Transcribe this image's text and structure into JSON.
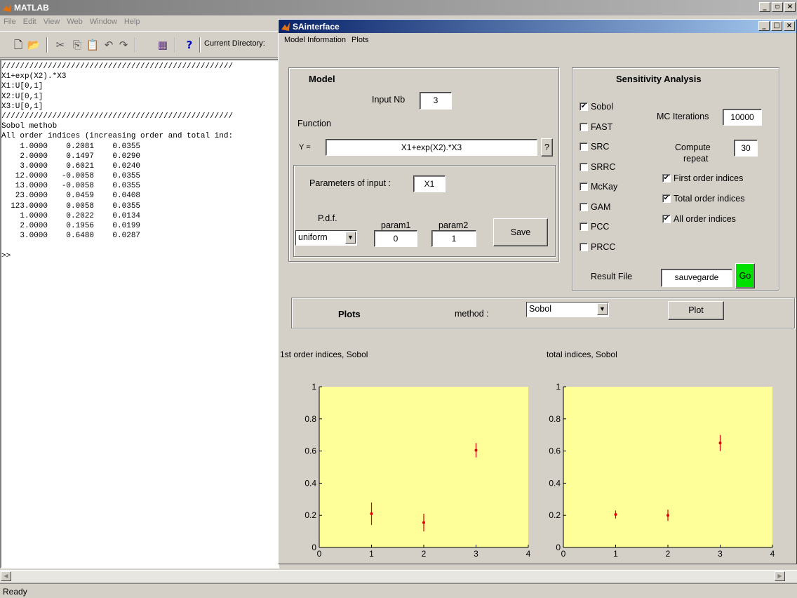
{
  "matlab": {
    "title": "MATLAB",
    "menu": [
      "File",
      "Edit",
      "View",
      "Web",
      "Window",
      "Help"
    ],
    "toolbar": {
      "current_dir_label": "Current Directory:"
    },
    "console_lines": [
      "//////////////////////////////////////////////////",
      "X1+exp(X2).*X3",
      "X1:U[0,1]",
      "X2:U[0,1]",
      "X3:U[0,1]",
      "//////////////////////////////////////////////////",
      "Sobol methob",
      "All order indices (increasing order and total ind:",
      "    1.0000    0.2081    0.0355",
      "    2.0000    0.1497    0.0290",
      "    3.0000    0.6021    0.0240",
      "   12.0000   -0.0058    0.0355",
      "   13.0000   -0.0058    0.0355",
      "   23.0000    0.0459    0.0408",
      "  123.0000    0.0058    0.0355",
      "    1.0000    0.2022    0.0134",
      "    2.0000    0.1956    0.0199",
      "    3.0000    0.6480    0.0287",
      "",
      ">>"
    ],
    "status": "Ready",
    "win_buttons": [
      "_",
      "̲̲",
      "×"
    ]
  },
  "sa": {
    "title": "SAinterface",
    "menu": [
      "Model Information",
      "Plots"
    ],
    "model": {
      "heading": "Model",
      "input_nb_label": "Input Nb",
      "input_nb_value": "3",
      "function_label": "Function",
      "y_label": "Y =",
      "function_value": "X1+exp(X2).*X3",
      "help_button": "?",
      "params_label": "Parameters of input :",
      "params_value": "X1",
      "pdf_label": "P.d.f.",
      "pdf_value": "uniform",
      "param1_label": "param1",
      "param1_value": "0",
      "param2_label": "param2",
      "param2_value": "1",
      "save_button": "Save"
    },
    "sensitivity": {
      "heading": "Sensitivity Analysis",
      "methods": [
        {
          "label": "Sobol",
          "checked": true
        },
        {
          "label": "FAST",
          "checked": false
        },
        {
          "label": "SRC",
          "checked": false
        },
        {
          "label": "SRRC",
          "checked": false
        },
        {
          "label": "McKay",
          "checked": false
        },
        {
          "label": "GAM",
          "checked": false
        },
        {
          "label": "PCC",
          "checked": false
        },
        {
          "label": "PRCC",
          "checked": false
        }
      ],
      "mc_label": "MC Iterations",
      "mc_value": "10000",
      "compute_label_1": "Compute",
      "compute_label_2": "repeat",
      "compute_value": "30",
      "options": [
        {
          "label": "First order indices",
          "checked": true
        },
        {
          "label": "Total order indices",
          "checked": true
        },
        {
          "label": "All order indices",
          "checked": true
        }
      ],
      "result_label": "Result File",
      "result_value": "sauvegarde",
      "go_button": "Go",
      "go_color": "#00e000"
    },
    "plots_panel": {
      "heading": "Plots",
      "method_label": "method :",
      "method_value": "Sobol",
      "plot_button": "Plot"
    }
  },
  "chart_data": [
    {
      "type": "scatter",
      "title": "1st order indices, Sobol",
      "x": [
        1,
        2,
        3
      ],
      "values": [
        0.21,
        0.155,
        0.605
      ],
      "error_low": [
        0.14,
        0.1,
        0.56
      ],
      "error_high": [
        0.28,
        0.21,
        0.65
      ],
      "xlim": [
        0,
        4
      ],
      "ylim": [
        0,
        1
      ],
      "xticks": [
        "0",
        "1",
        "2",
        "3",
        "4"
      ],
      "yticks": [
        "0",
        "0.2",
        "0.4",
        "0.6",
        "0.8",
        "1"
      ],
      "background": "#ffff99",
      "marker_color": "#e00000"
    },
    {
      "type": "scatter",
      "title": "total indices, Sobol",
      "x": [
        1,
        2,
        3
      ],
      "values": [
        0.205,
        0.2,
        0.65
      ],
      "error_low": [
        0.18,
        0.165,
        0.6
      ],
      "error_high": [
        0.23,
        0.235,
        0.7
      ],
      "xlim": [
        0,
        4
      ],
      "ylim": [
        0,
        1
      ],
      "xticks": [
        "0",
        "1",
        "2",
        "3",
        "4"
      ],
      "yticks": [
        "0",
        "0.2",
        "0.4",
        "0.6",
        "0.8",
        "1"
      ],
      "background": "#ffff99",
      "marker_color": "#e00000"
    }
  ]
}
